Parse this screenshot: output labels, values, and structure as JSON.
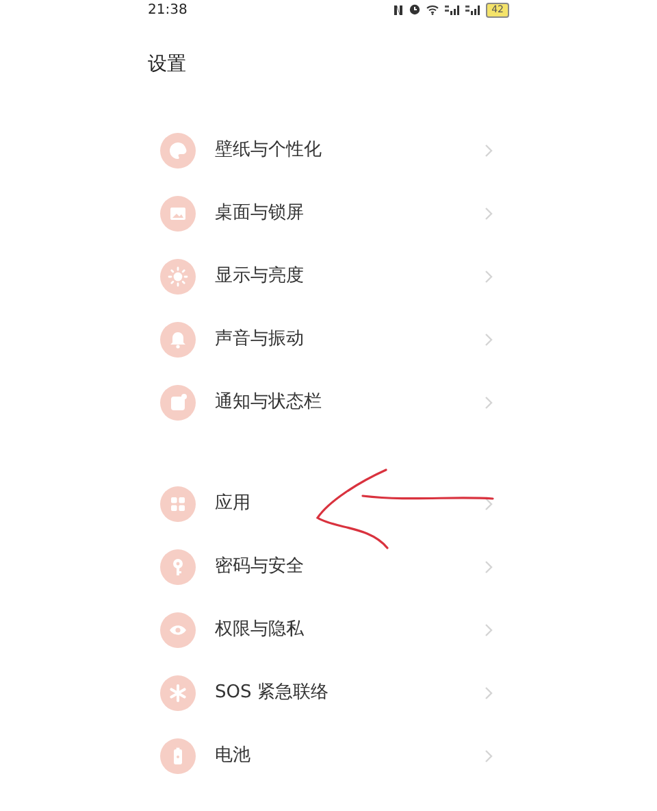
{
  "status_bar": {
    "time": "21:38",
    "battery": "42"
  },
  "title": "设置",
  "groups": [
    {
      "items": [
        {
          "label": "壁纸与个性化"
        },
        {
          "label": "桌面与锁屏"
        },
        {
          "label": "显示与亮度"
        },
        {
          "label": "声音与振动"
        },
        {
          "label": "通知与状态栏"
        }
      ]
    },
    {
      "items": [
        {
          "label": "应用"
        },
        {
          "label": "密码与安全"
        },
        {
          "label": "权限与隐私"
        },
        {
          "label": "SOS 紧急联络"
        },
        {
          "label": "电池"
        }
      ]
    }
  ]
}
